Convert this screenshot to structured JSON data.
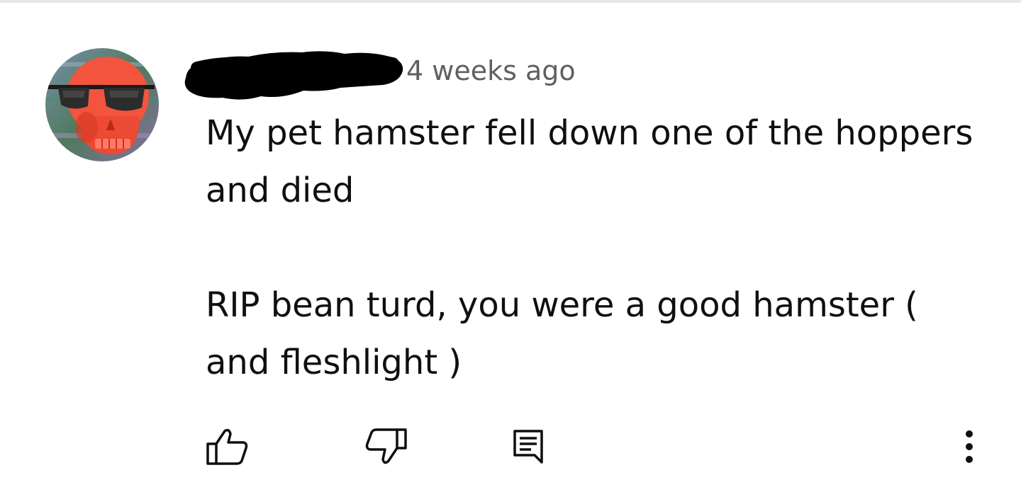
{
  "comment": {
    "timestamp": "4 weeks ago",
    "body": {
      "paragraph_1": "My pet hamster fell down one of the hoppers and died",
      "paragraph_2": "RIP bean turd, you were a good hamster ( and fleshlight )"
    },
    "actions": {
      "like_icon": "thumb-up-icon",
      "dislike_icon": "thumb-down-icon",
      "reply_icon": "reply-comment-icon",
      "more_icon": "vertical-dots-icon"
    }
  },
  "colors": {
    "timestamp": "#606060",
    "text": "#0f0f0f",
    "icon": "#0f0f0f",
    "redaction": "#000000",
    "avatar_skull": "#f2543d"
  }
}
